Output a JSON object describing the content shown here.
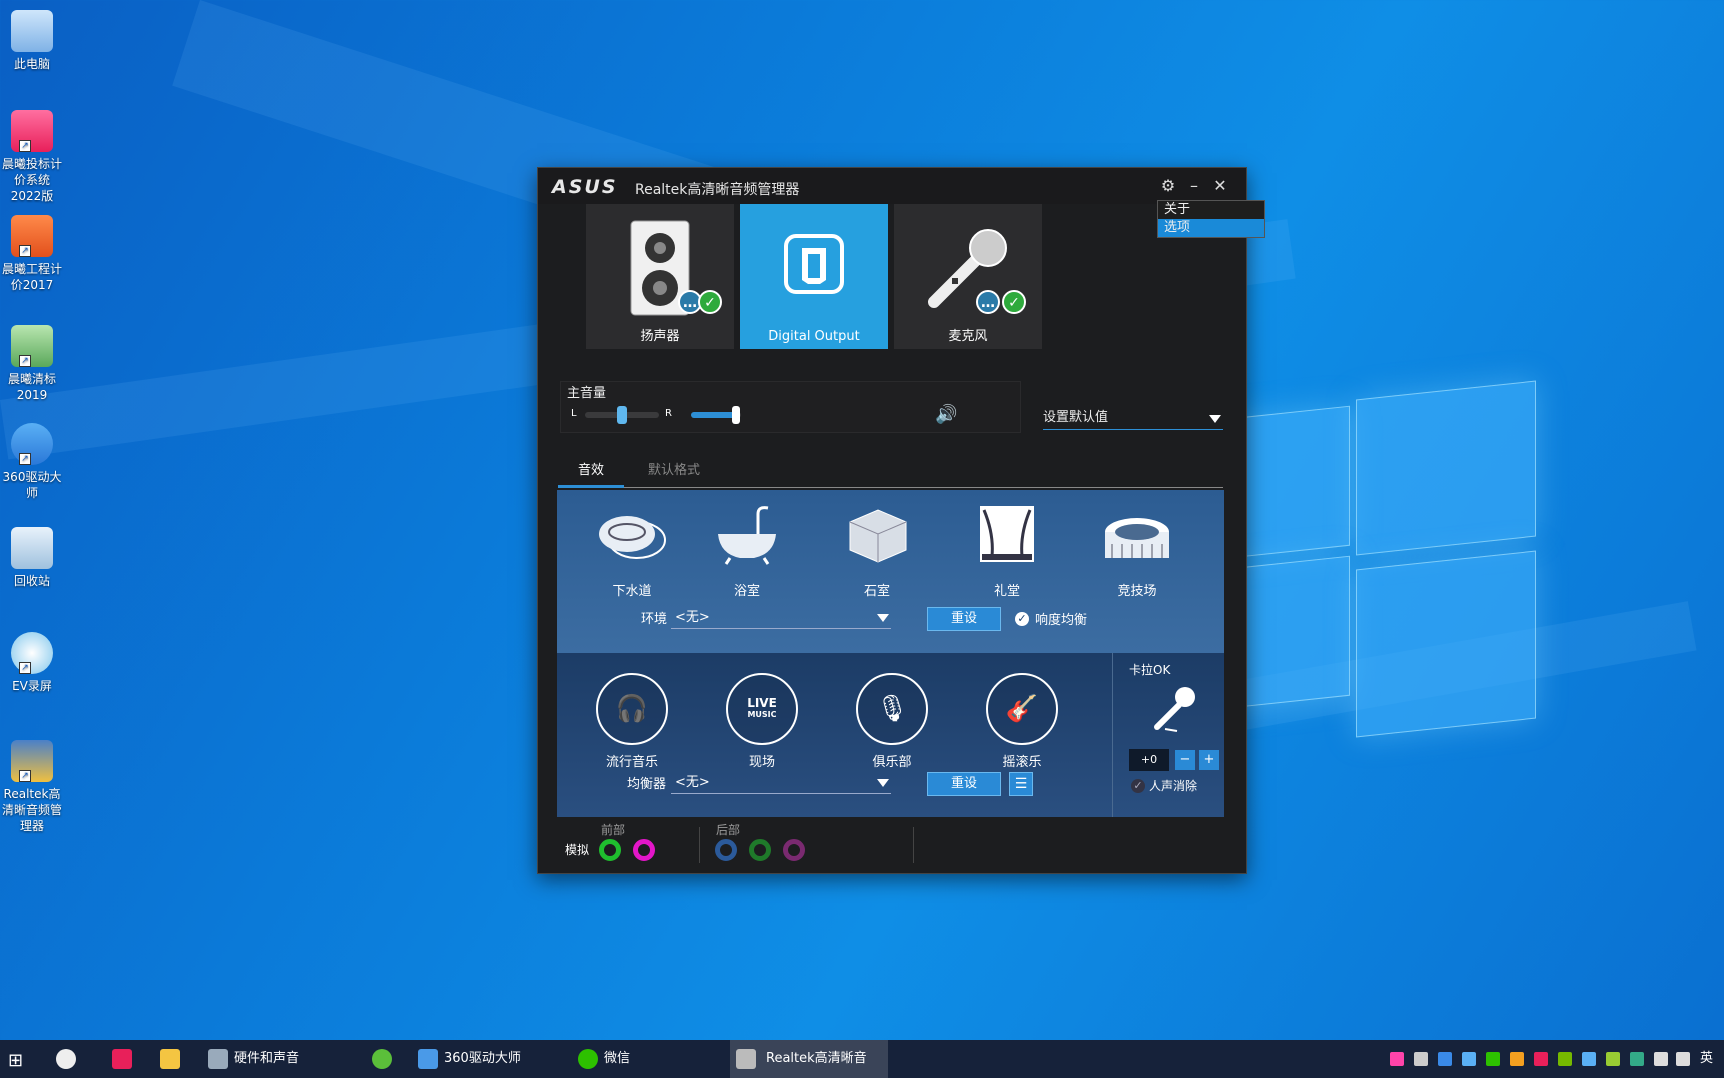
{
  "desktop": {
    "icons": [
      {
        "label": "此电脑"
      },
      {
        "label": "晨曦投标计价系统2022版"
      },
      {
        "label": "晨曦工程计价2017"
      },
      {
        "label": "晨曦清标2019"
      },
      {
        "label": "360驱动大师"
      },
      {
        "label": "回收站"
      },
      {
        "label": "EV录屏"
      },
      {
        "label": "Realtek高清晰音频管理器"
      }
    ]
  },
  "window": {
    "brand": "ASUS",
    "title": "Realtek高清晰音频管理器",
    "menu": {
      "about": "关于",
      "options": "选项"
    },
    "devices": [
      {
        "label": "扬声器"
      },
      {
        "label": "Digital Output"
      },
      {
        "label": "麦克风"
      }
    ],
    "volume": {
      "title": "主音量",
      "left": "L",
      "right": "R",
      "balance": 0.5,
      "level": 0.9
    },
    "default_select": "设置默认值",
    "tabs": [
      {
        "label": "音效"
      },
      {
        "label": "默认格式"
      }
    ],
    "environments": [
      {
        "label": "下水道"
      },
      {
        "label": "浴室"
      },
      {
        "label": "石室"
      },
      {
        "label": "礼堂"
      },
      {
        "label": "竞技场"
      }
    ],
    "env_row": {
      "label": "环境",
      "value": "<无>",
      "reset": "重设",
      "loudness": "响度均衡"
    },
    "eq_presets": [
      {
        "label": "流行音乐"
      },
      {
        "label": "现场"
      },
      {
        "label": "俱乐部"
      },
      {
        "label": "摇滚乐"
      }
    ],
    "live_badge": {
      "line1": "LIVE",
      "line2": "MUSIC"
    },
    "eq_row": {
      "label": "均衡器",
      "value": "<无>",
      "reset": "重设"
    },
    "karaoke": {
      "title": "卡拉OK",
      "value": "+0",
      "minus": "−",
      "plus": "+",
      "vocal_cancel": "人声消除"
    },
    "connectors": {
      "analog": "模拟",
      "front": "前部",
      "rear": "后部"
    }
  },
  "taskbar": {
    "items": [
      {
        "label": "硬件和声音"
      },
      {
        "label": "360驱动大师"
      },
      {
        "label": "微信"
      },
      {
        "label": "Realtek高清晰音频..."
      }
    ],
    "ime": "英"
  },
  "colors": {
    "accent": "#26a0df",
    "ok": "#2eaa3c",
    "jack_green": "#1fbf2e",
    "jack_pink": "#e316c8",
    "jack_blue": "#2b5a9a",
    "jack_dark_green": "#1f7a2a",
    "jack_purple": "#7a2a70"
  }
}
